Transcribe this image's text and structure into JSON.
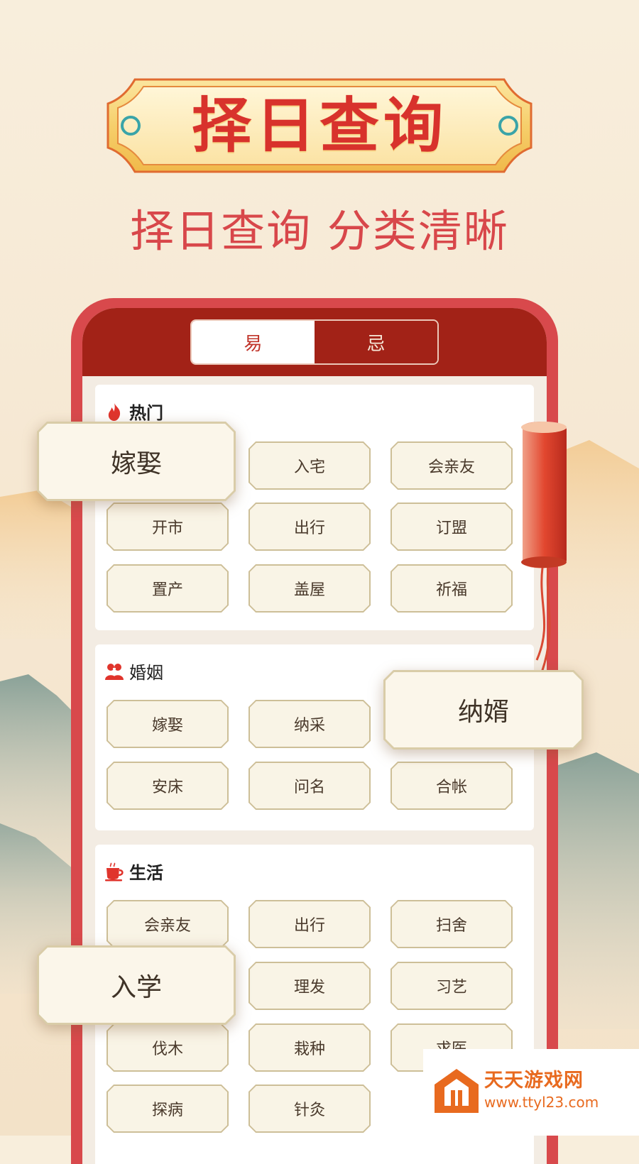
{
  "banner": {
    "title": "择日查询"
  },
  "subtitle": "择日查询 分类清晰",
  "tabs": [
    {
      "label": "易",
      "active": true
    },
    {
      "label": "忌",
      "active": false
    }
  ],
  "sections": [
    {
      "title": "热门",
      "icon": "flame-icon",
      "items": [
        "嫁娶",
        "入宅",
        "会亲友",
        "开市",
        "出行",
        "订盟",
        "置产",
        "盖屋",
        "祈福"
      ]
    },
    {
      "title": "婚姻",
      "icon": "couple-icon",
      "items": [
        "嫁娶",
        "纳采",
        "纳婿",
        "安床",
        "问名",
        "合帐"
      ]
    },
    {
      "title": "生活",
      "icon": "teacup-icon",
      "items": [
        "会亲友",
        "出行",
        "扫舍",
        "入学",
        "理发",
        "习艺",
        "伐木",
        "栽种",
        "求医",
        "探病",
        "针灸"
      ]
    }
  ],
  "popups": [
    "嫁娶",
    "纳婿",
    "入学"
  ],
  "watermark": {
    "title": "天天游戏网",
    "url": "www.ttyl23.com"
  },
  "colors": {
    "primary_red": "#a22217",
    "accent_red": "#d8322c",
    "chip_bg": "#f9f4e6",
    "chip_border": "#cdbf98"
  }
}
